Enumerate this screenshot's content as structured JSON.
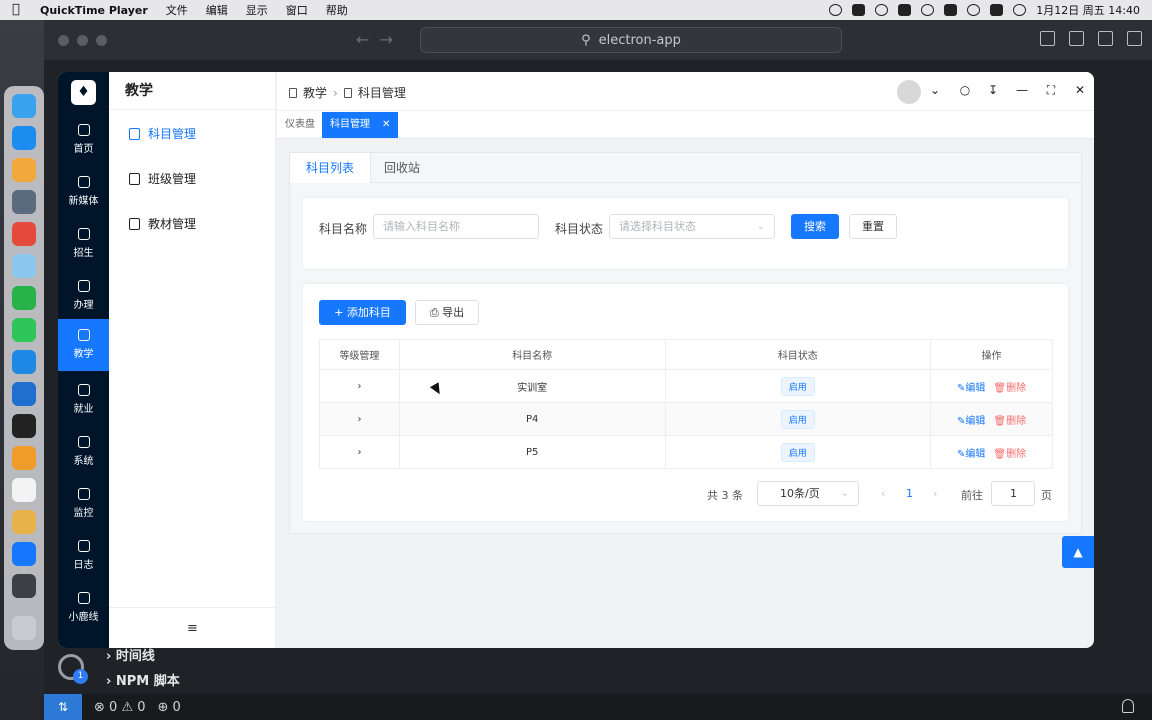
{
  "menubar": {
    "app_name": "QuickTime Player",
    "menus": [
      "文件",
      "编辑",
      "显示",
      "窗口",
      "帮助"
    ],
    "datetime": "1月12日 周五 14:40"
  },
  "window": {
    "command_center": "electron-app"
  },
  "vscode": {
    "tree_items": [
      "时间线",
      "NPM 脚本"
    ],
    "settings_badge": "1",
    "status_errors": "0",
    "status_warnings": "0",
    "status_ports": "0"
  },
  "rail": {
    "items": [
      {
        "label": "首页",
        "icon": "home-icon"
      },
      {
        "label": "新媒体",
        "icon": "tablet-icon"
      },
      {
        "label": "招生",
        "icon": "headset-icon"
      },
      {
        "label": "办理",
        "icon": "edit-icon"
      },
      {
        "label": "教学",
        "icon": "teaching-icon"
      },
      {
        "label": "就业",
        "icon": "user-icon"
      },
      {
        "label": "系统",
        "icon": "gear-icon"
      },
      {
        "label": "监控",
        "icon": "monitor-icon"
      },
      {
        "label": "日志",
        "icon": "log-icon"
      },
      {
        "label": "小鹿线",
        "icon": "bug-icon"
      }
    ]
  },
  "submenu": {
    "title": "教学",
    "items": [
      {
        "label": "科目管理",
        "icon": "book-icon"
      },
      {
        "label": "班级管理",
        "icon": "house-icon"
      },
      {
        "label": "教材管理",
        "icon": "notebook-icon"
      }
    ]
  },
  "breadcrumb": [
    "教学",
    "科目管理"
  ],
  "tags": [
    {
      "label": "仪表盘"
    },
    {
      "label": "科目管理"
    }
  ],
  "tabs": [
    "科目列表",
    "回收站"
  ],
  "search": {
    "name_label": "科目名称",
    "name_placeholder": "请输入科目名称",
    "status_label": "科目状态",
    "status_placeholder": "请选择科目状态",
    "search_btn": "搜索",
    "reset_btn": "重置"
  },
  "toolbar": {
    "add_btn": "添加科目",
    "export_btn": "导出"
  },
  "table": {
    "headers": [
      "等级管理",
      "科目名称",
      "科目状态",
      "操作"
    ],
    "rows": [
      {
        "name": "实训室",
        "status": "启用"
      },
      {
        "name": "P4",
        "status": "启用"
      },
      {
        "name": "P5",
        "status": "启用"
      }
    ],
    "edit_label": "编辑",
    "delete_label": "删除"
  },
  "pagination": {
    "total_text": "共 3 条",
    "page_size": "10条/页",
    "current_page": "1",
    "goto_label": "前往",
    "goto_value": "1",
    "page_suffix": "页"
  },
  "colors": {
    "primary": "#1677ff",
    "rail_bg": "#001529",
    "danger": "#f56c6c"
  }
}
